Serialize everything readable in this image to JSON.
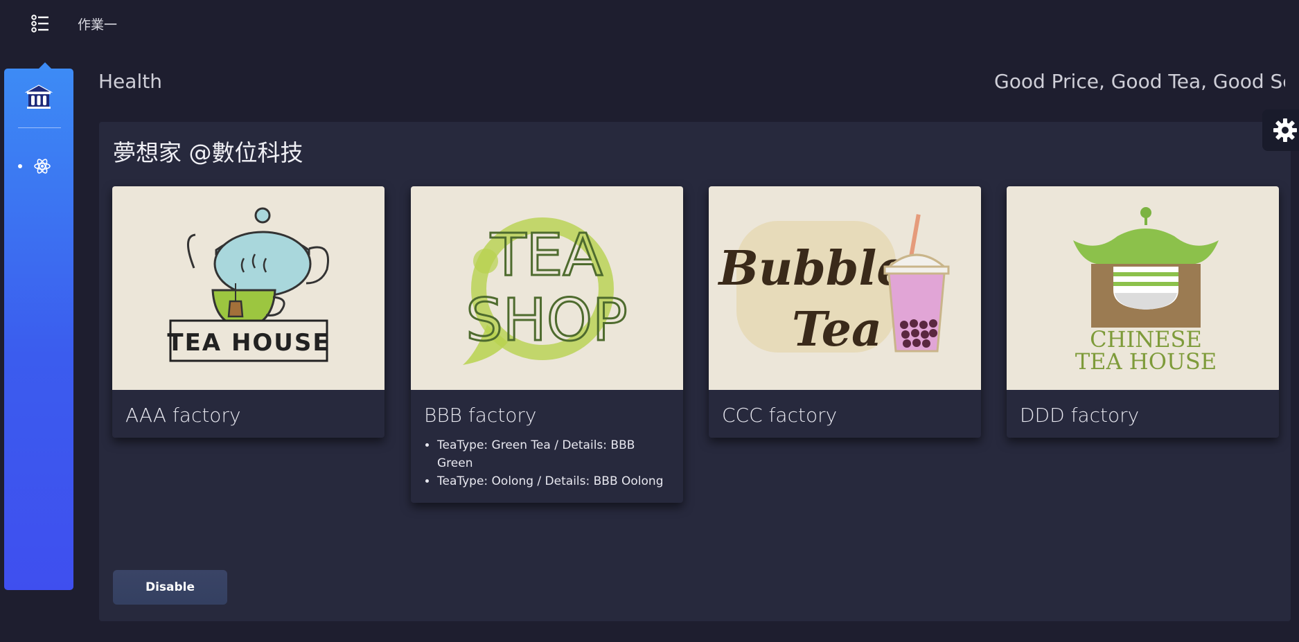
{
  "topbar": {
    "menu_icon": "list-menu-icon",
    "title": "作業一"
  },
  "sidebar": {
    "logo_icon": "university-icon",
    "items": [
      {
        "icon": "atom-icon"
      }
    ],
    "colors": {
      "top": "#3d8bf5",
      "bottom": "#3f4fef"
    }
  },
  "header": {
    "section_title": "Health",
    "tagline": "Good Price, Good Tea, Good Service"
  },
  "card": {
    "title": "夢想家 @數位科技",
    "factories": [
      {
        "name": "AAA factory",
        "logo_text": [
          "TEA HOUSE"
        ],
        "details": []
      },
      {
        "name": "BBB factory",
        "logo_text": [
          "TEA",
          "SHOP"
        ],
        "details": [
          "TeaType: Green Tea / Details: BBB Green",
          "TeaType: Oolong / Details: BBB Oolong"
        ]
      },
      {
        "name": "CCC factory",
        "logo_text": [
          "Bubble",
          "Tea"
        ],
        "details": []
      },
      {
        "name": "DDD factory",
        "logo_text": [
          "CHINESE",
          "TEA HOUSE"
        ],
        "details": []
      }
    ],
    "disable_label": "Disable"
  },
  "settings": {
    "icon": "gear-icon"
  },
  "colors": {
    "background": "#1e1e2f",
    "card": "#27293d",
    "logo_bg": "#ece6d9",
    "button": "#344061"
  }
}
